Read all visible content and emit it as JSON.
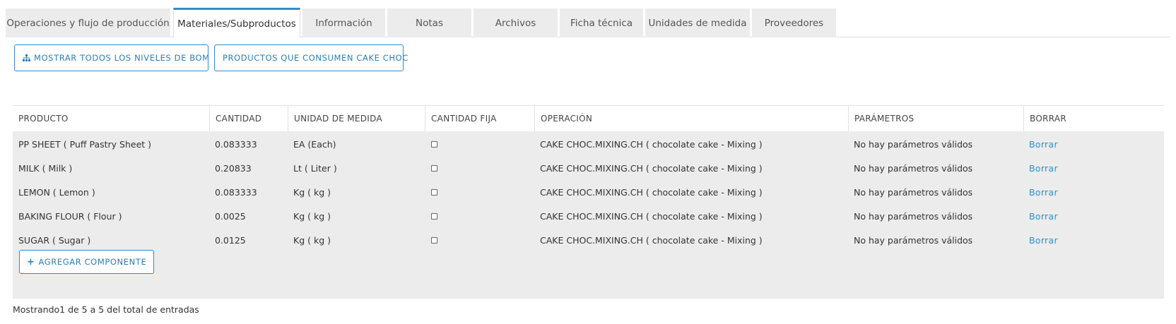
{
  "tabs": [
    {
      "label": "Operaciones y flujo de producción",
      "active": false
    },
    {
      "label": "Materiales/Subproductos",
      "active": true
    },
    {
      "label": "Información",
      "active": false
    },
    {
      "label": "Notas",
      "active": false
    },
    {
      "label": "Archivos",
      "active": false
    },
    {
      "label": "Ficha técnica",
      "active": false
    },
    {
      "label": "Unidades de medida",
      "active": false
    },
    {
      "label": "Proveedores",
      "active": false
    }
  ],
  "actions": {
    "show_bom_levels": {
      "label": "MOSTRAR TODOS LOS NIVELES DE BOM",
      "icon": "sitemap-icon"
    },
    "consuming_products": {
      "label": "PRODUCTOS QUE CONSUMEN CAKE CHOC"
    }
  },
  "table": {
    "columns": [
      "PRODUCTO",
      "CANTIDAD",
      "UNIDAD DE MEDIDA",
      "CANTIDAD FIJA",
      "OPERACIÓN",
      "PARÁMETROS",
      "BORRAR"
    ],
    "rows": [
      {
        "producto": "PP SHEET ( Puff Pastry Sheet )",
        "cantidad": "0.083333",
        "unidad": "EA (Each)",
        "fija": false,
        "operacion": "CAKE CHOC.MIXING.CH ( chocolate cake - Mixing )",
        "parametros": "No hay parámetros válidos",
        "borrar": "Borrar"
      },
      {
        "producto": "MILK ( Milk )",
        "cantidad": "0.20833",
        "unidad": "Lt ( Liter )",
        "fija": false,
        "operacion": "CAKE CHOC.MIXING.CH ( chocolate cake - Mixing )",
        "parametros": "No hay parámetros válidos",
        "borrar": "Borrar"
      },
      {
        "producto": "LEMON ( Lemon )",
        "cantidad": "0.083333",
        "unidad": "Kg ( kg )",
        "fija": false,
        "operacion": "CAKE CHOC.MIXING.CH ( chocolate cake - Mixing )",
        "parametros": "No hay parámetros válidos",
        "borrar": "Borrar"
      },
      {
        "producto": "BAKING FLOUR ( Flour )",
        "cantidad": "0.0025",
        "unidad": "Kg ( kg )",
        "fija": false,
        "operacion": "CAKE CHOC.MIXING.CH ( chocolate cake - Mixing )",
        "parametros": "No hay parámetros válidos",
        "borrar": "Borrar"
      },
      {
        "producto": "SUGAR ( Sugar )",
        "cantidad": "0.0125",
        "unidad": "Kg ( kg )",
        "fija": false,
        "operacion": "CAKE CHOC.MIXING.CH ( chocolate cake - Mixing )",
        "parametros": "No hay parámetros válidos",
        "borrar": "Borrar"
      }
    ],
    "add_component": "AGREGAR COMPONENTE"
  },
  "footer": {
    "summary": "Mostrando1 de 5 a 5 del total de entradas"
  },
  "colors": {
    "accent": "#2a8fd0",
    "row_bg": "#ececec",
    "tab_bg": "#ececec"
  }
}
